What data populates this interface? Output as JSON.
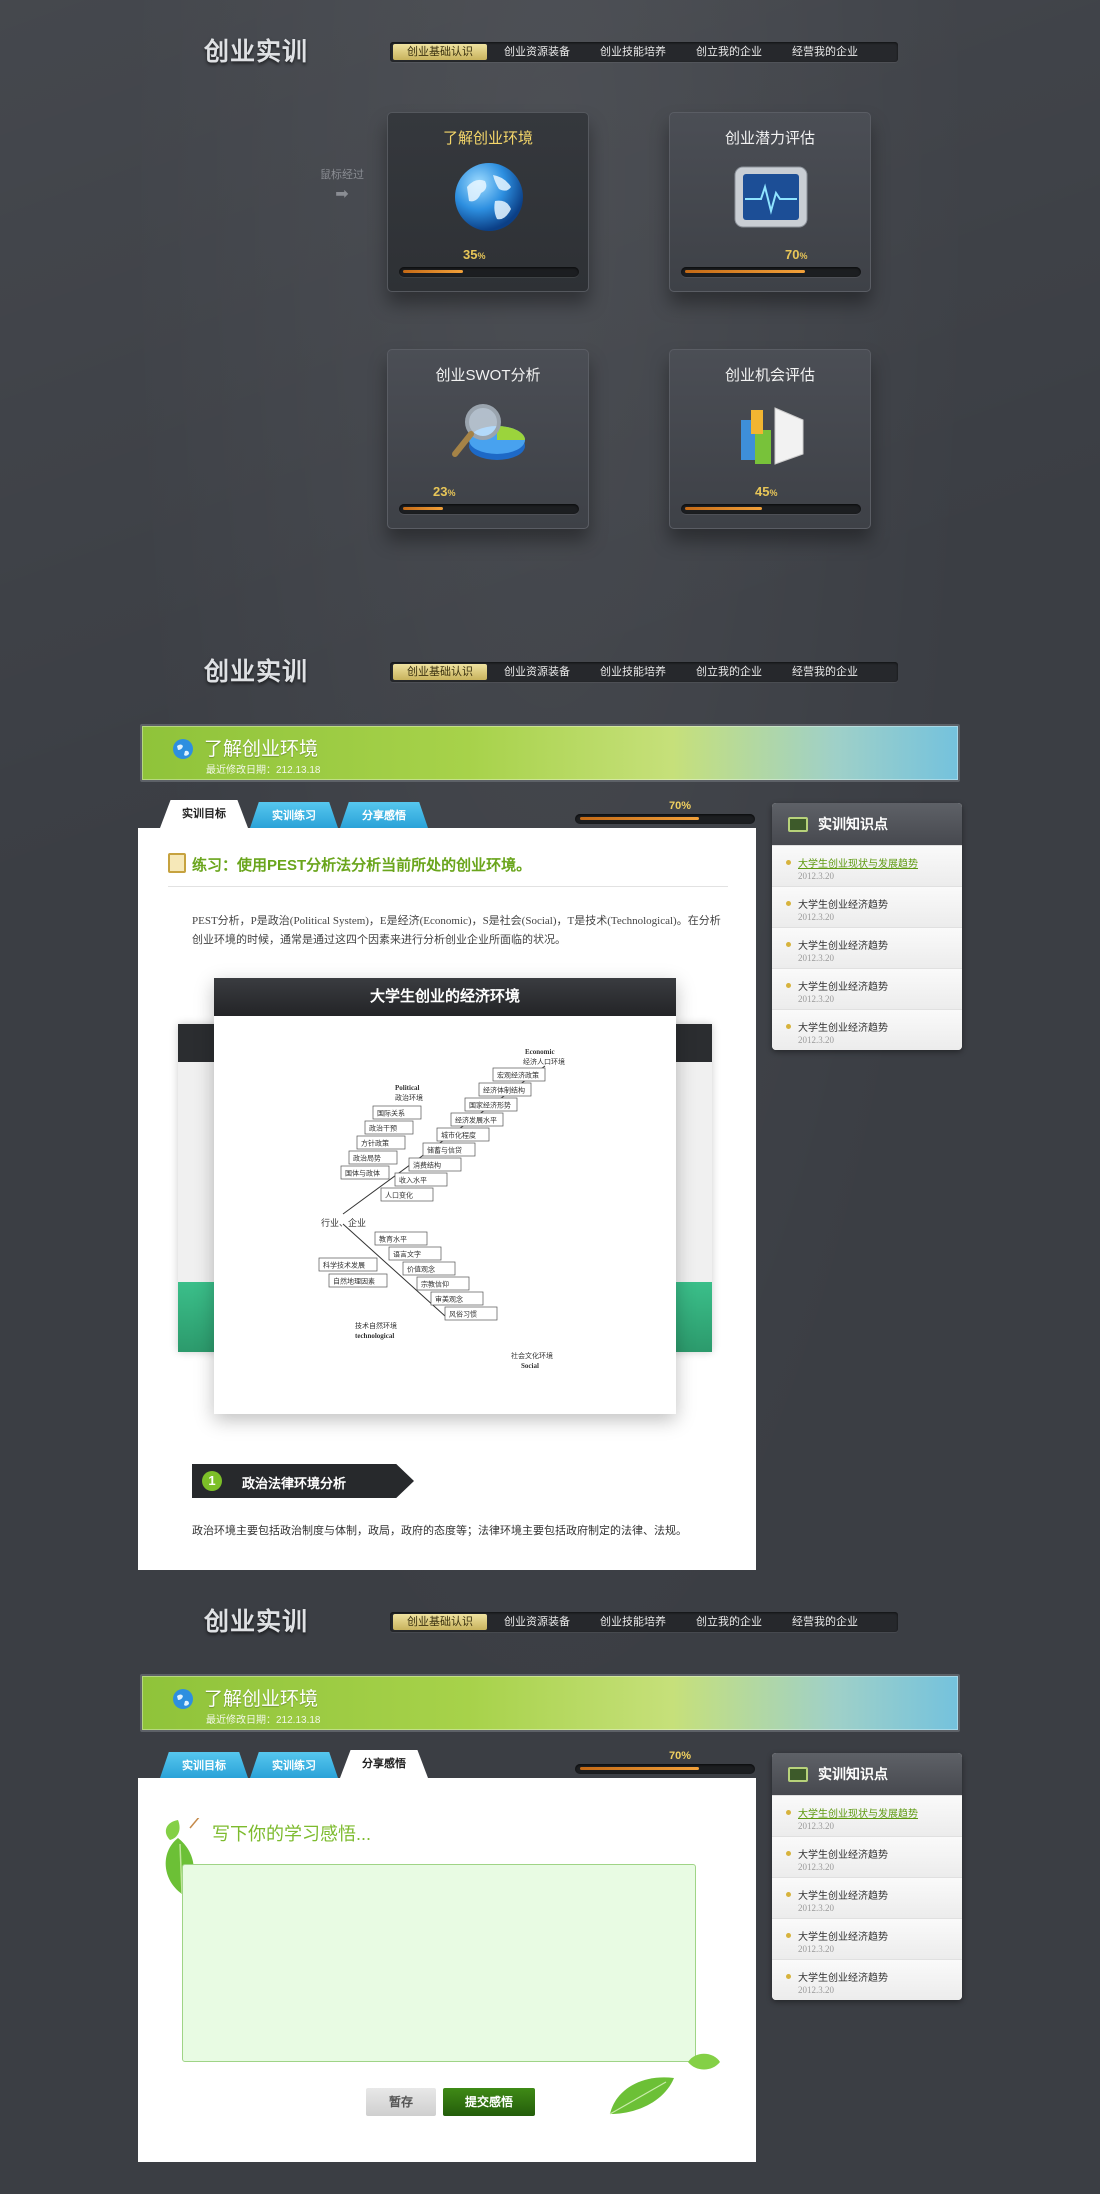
{
  "brand": "创业实训",
  "nav": [
    "创业基础认识",
    "创业资源装备",
    "创业技能培养",
    "创立我的企业",
    "经营我的企业"
  ],
  "hover_hint": "鼠标经过",
  "cards": [
    {
      "title": "了解创业环境",
      "percent": "35",
      "progress": 0.35,
      "icon": "globe-icon",
      "active": true
    },
    {
      "title": "创业潜力评估",
      "percent": "70",
      "progress": 0.7,
      "icon": "monitor-icon",
      "active": false
    },
    {
      "title": "创业SWOT分析",
      "percent": "23",
      "progress": 0.23,
      "icon": "magnifier-pie-icon",
      "active": false
    },
    {
      "title": "创业机会评估",
      "percent": "45",
      "progress": 0.45,
      "icon": "bar-chart-icon",
      "active": false
    }
  ],
  "percent_sign": "%",
  "banner": {
    "title": "了解创业环境",
    "date": "最近修改日期：212.13.18"
  },
  "tabs": [
    "实训目标",
    "实训练习",
    "分享感悟"
  ],
  "progress": {
    "label": "70%",
    "value": 0.7
  },
  "knowledge": {
    "title": "实训知识点",
    "items": [
      {
        "title": "大学生创业现状与发展趋势",
        "date": "2012.3.20"
      },
      {
        "title": "大学生创业经济趋势",
        "date": "2012.3.20"
      },
      {
        "title": "大学生创业经济趋势",
        "date": "2012.3.20"
      },
      {
        "title": "大学生创业经济趋势",
        "date": "2012.3.20"
      },
      {
        "title": "大学生创业经济趋势",
        "date": "2012.3.20"
      }
    ]
  },
  "exercise": {
    "title": "练习：使用PEST分析法分析当前所处的创业环境。",
    "text": "PEST分析，P是政治(Political System)，E是经济(Economic)，S是社会(Social)，T是技术(Technological)。在分析创业环境的时候，通常是通过这四个因素来进行分析创业企业所面临的状况。",
    "figure_title": "大学生创业的经济环境",
    "section_num": "1",
    "section_title": "政治法律环境分析",
    "section_text": "政治环境主要包括政治制度与体制，政局，政府的态度等；法律环境主要包括政府制定的法律、法规。"
  },
  "diagram": {
    "economic_label": "Economic",
    "economic_cn": "经济人口环境",
    "political_label": "Political",
    "political_cn": "政治环境",
    "center": "行业、企业",
    "tech_cn": "技术自然环境",
    "tech_label": "technological",
    "social_cn": "社会文化环境",
    "social_label": "Social",
    "top_right": [
      "宏观经济政策",
      "经济体制结构",
      "国家经济形势",
      "经济发展水平",
      "城市化程度",
      "储蓄与信贷",
      "消费结构",
      "收入水平",
      "人口变化"
    ],
    "top_left": [
      "国际关系",
      "政治干预",
      "方针政策",
      "政治局势",
      "国体与政体"
    ],
    "bottom": [
      "教育水平",
      "语言文字",
      "价值观念",
      "宗教信仰",
      "审美观念",
      "风俗习惯"
    ],
    "bottom_left": [
      "科学技术发展",
      "自然地理因素"
    ]
  },
  "reflection": {
    "title": "写下你的学习感悟...",
    "save": "暂存",
    "submit": "提交感悟"
  }
}
